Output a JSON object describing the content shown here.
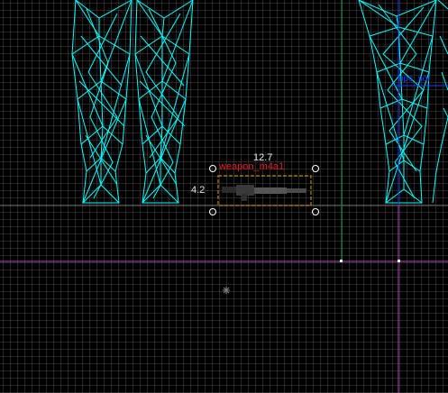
{
  "viewport": {
    "grid_color": "#464646",
    "wireframe_color": "#00ffff",
    "axis_x_color": "#c040c0",
    "axis_y_color": "#20a040",
    "selection_color": "#e0a000"
  },
  "selection": {
    "width_readout": "12.7",
    "height_readout": "4.2",
    "entity_name": "weapon_m4a1",
    "label_color": "#e02020"
  },
  "background_entity": {
    "name": "npc_sol",
    "color": "#1a3dff"
  }
}
